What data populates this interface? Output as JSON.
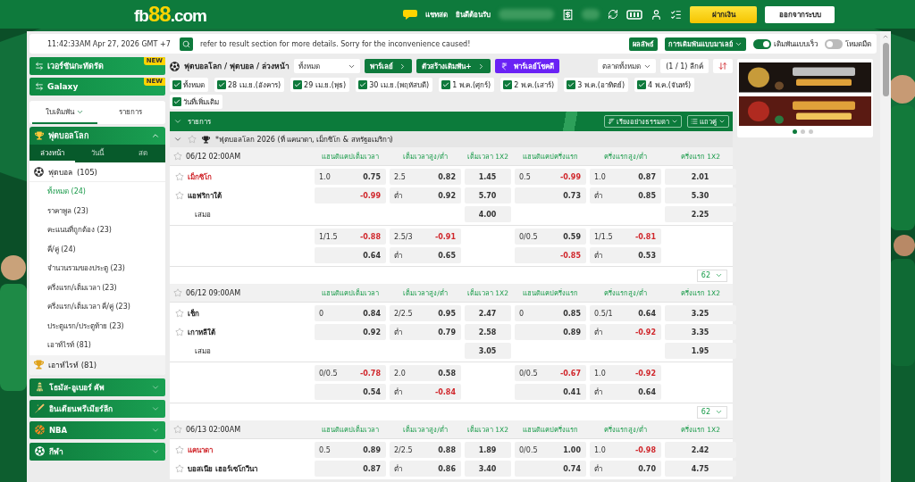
{
  "header": {
    "logo": [
      {
        "text": "fb",
        "accent": false
      },
      {
        "text": "88",
        "accent": true
      },
      {
        "text": ".com",
        "accent": false
      }
    ],
    "chat": "แชทสด",
    "welcome": "ยินดีต้อนรับ",
    "buttons": [
      {
        "label": "ฝากเงิน",
        "kind": "primary"
      },
      {
        "label": "ออกจากระบบ",
        "kind": "secondary"
      }
    ]
  },
  "topbar": {
    "clock": "11:42:33AM Apr 27, 2026 GMT +7",
    "notice": "refer to result section for more details. Sorry for the inconvenience caused!",
    "results": "ผลลัพธ์",
    "odds_type": "การเดิมพันแบบมาเลย์",
    "toggles": [
      {
        "label": "เดิมพันแบบเร็ว",
        "on": true
      },
      {
        "label": "โหมดมืด",
        "on": false
      }
    ]
  },
  "sidebar": {
    "banners": [
      {
        "label": "เวอร์ชันกะทัดรัด",
        "ribbon": "NEW"
      },
      {
        "label": "Galaxy",
        "ribbon": "NEW"
      }
    ],
    "tabs": [
      {
        "label": "ใบเดิมพัน",
        "selected": true
      },
      {
        "label": "รายการ",
        "selected": false
      }
    ],
    "section": {
      "title": "ฟุตบอลโลก",
      "expanded": true,
      "tabs": [
        {
          "label": "ล่วงหน้า",
          "selected": true
        },
        {
          "label": "วันนี้",
          "selected": false
        },
        {
          "label": "สด",
          "selected": false
        }
      ],
      "sport": "ฟุตบอล",
      "sport_count": "(105)",
      "items": [
        {
          "label": "ทั้งหมด",
          "count": "(24)",
          "selected": true
        },
        {
          "label": "ราคาพูล",
          "count": "(23)",
          "selected": false
        },
        {
          "label": "คะแนนที่ถูกต้อง",
          "count": "(23)",
          "selected": false
        },
        {
          "label": "คี่/คู่",
          "count": "(24)",
          "selected": false
        },
        {
          "label": "จำนวนรวมของประตู",
          "count": "(23)",
          "selected": false
        },
        {
          "label": "ครึ่งแรก/เต็มเวลา",
          "count": "(23)",
          "selected": false
        },
        {
          "label": "ครึ่งแรก/เต็มเวลา คี่/คู่",
          "count": "(23)",
          "selected": false
        },
        {
          "label": "ประตูแรก/ประตูท้าย",
          "count": "(23)",
          "selected": false
        },
        {
          "label": "เอาท์ไรท์",
          "count": "(81)",
          "selected": false
        }
      ],
      "outright": "เอาท์ไรท์",
      "outright_count": "(81)"
    },
    "groups": [
      {
        "label": "โธมัส-อูเบอร์ คัพ",
        "kind": "badminton",
        "expanded": false
      },
      {
        "label": "อินเดียนพรีเมียร์ลีก",
        "kind": "cricket",
        "expanded": false
      },
      {
        "label": "NBA",
        "kind": "basketball",
        "expanded": false
      },
      {
        "label": "กีฬา",
        "kind": "football",
        "expanded": false
      }
    ]
  },
  "main": {
    "breadcrumb": "ฟุตบอลโลก / ฟุตบอล / ล่วงหน้า",
    "filter": "ทั้งหมด",
    "actions": [
      {
        "label": "พาร์เลย์",
        "kind": "green"
      },
      {
        "label": "ตัวสร้างเดิมพัน+",
        "kind": "green"
      },
      {
        "label": "พาร์เลย์โชคดี",
        "kind": "purple"
      }
    ],
    "markets": "ตลาดทั้งหมด",
    "league_count": "(1 / 1) ลีกค์",
    "dates": [
      {
        "label": "ทั้งหมด",
        "checked": true
      },
      {
        "label": "28 เม.ย.(อังคาร)",
        "checked": true
      },
      {
        "label": "29 เม.ย.(พุธ)",
        "checked": true
      },
      {
        "label": "30 เม.ย.(พฤหัสบดี)",
        "checked": true
      },
      {
        "label": "1 พ.ค.(ศุกร์)",
        "checked": true
      },
      {
        "label": "2 พ.ค.(เสาร์)",
        "checked": true
      },
      {
        "label": "3 พ.ค.(อาทิตย์)",
        "checked": true
      },
      {
        "label": "4 พ.ค.(จันทร์)",
        "checked": true
      },
      {
        "label": "วันที่เพิ่มเติม",
        "checked": true
      }
    ],
    "table_title": "รายการ",
    "sort": "เรียงอย่างธรรมดา",
    "view": "แถวคู่",
    "league": "*ฟุตบอลโลก 2026 (ที่ แคนาดา, เม็กซิโก & สหรัฐอเมริกา)",
    "matches": [
      {
        "time": "06/12 02:00AM",
        "columns": [
          "แฮนดิแคปเต็มเวลา",
          "เต็มเวลาสูง/ต่ำ",
          "เต็มเวลา 1X2",
          "แฮนดิแคปครึ่งแรก",
          "ครึ่งแรกสูง/ต่ำ",
          "ครึ่งแรก 1X2"
        ],
        "teams": [
          {
            "name": "เม็กซิโก",
            "favorite": true
          },
          {
            "name": "แอฟริกาใต้",
            "favorite": false
          }
        ],
        "draw": "เสมอ",
        "more": "62",
        "lines": [
          [
            [
              {
                "line": "1.0",
                "price": "0.75",
                "negative": false
              },
              {
                "price": "-0.99",
                "negative": true
              }
            ],
            [
              {
                "line": "2.5",
                "price": "0.82",
                "negative": false
              },
              {
                "line": "ต่ำ",
                "price": "0.92",
                "negative": false
              }
            ],
            [
              {
                "price": "1.45",
                "negative": false
              },
              {
                "price": "5.70",
                "negative": false
              },
              {
                "price": "4.00",
                "negative": false
              }
            ],
            [
              {
                "line": "0.5",
                "price": "-0.99",
                "negative": true
              },
              {
                "price": "0.73",
                "negative": false
              }
            ],
            [
              {
                "line": "1.0",
                "price": "0.87",
                "negative": false
              },
              {
                "line": "ต่ำ",
                "price": "0.85",
                "negative": false
              }
            ],
            [
              {
                "price": "2.01",
                "negative": false
              },
              {
                "price": "5.30",
                "negative": false
              },
              {
                "price": "2.25",
                "negative": false
              }
            ]
          ],
          [
            [
              {
                "line": "1/1.5",
                "price": "-0.88",
                "negative": true
              },
              {
                "price": "0.64",
                "negative": false
              }
            ],
            [
              {
                "line": "2.5/3",
                "price": "-0.91",
                "negative": true
              },
              {
                "line": "ต่ำ",
                "price": "0.65",
                "negative": false
              }
            ],
            {
              "kind": "blank"
            },
            [
              {
                "line": "0/0.5",
                "price": "0.59",
                "negative": false
              },
              {
                "price": "-0.85",
                "negative": true
              }
            ],
            [
              {
                "line": "1/1.5",
                "price": "-0.81",
                "negative": true
              },
              {
                "line": "ต่ำ",
                "price": "0.53",
                "negative": false
              }
            ],
            {
              "kind": "blank"
            }
          ]
        ]
      },
      {
        "time": "06/12 09:00AM",
        "columns": [
          "แฮนดิแคปเต็มเวลา",
          "เต็มเวลาสูง/ต่ำ",
          "เต็มเวลา 1X2",
          "แฮนดิแคปครึ่งแรก",
          "ครึ่งแรกสูง/ต่ำ",
          "ครึ่งแรก 1X2"
        ],
        "teams": [
          {
            "name": "เช็ก",
            "favorite": false
          },
          {
            "name": "เกาหลีใต้",
            "favorite": false
          }
        ],
        "draw": "เสมอ",
        "more": "62",
        "lines": [
          [
            [
              {
                "line": "0",
                "price": "0.84",
                "negative": false
              },
              {
                "price": "0.92",
                "negative": false
              }
            ],
            [
              {
                "line": "2/2.5",
                "price": "0.95",
                "negative": false
              },
              {
                "line": "ต่ำ",
                "price": "0.79",
                "negative": false
              }
            ],
            [
              {
                "price": "2.47",
                "negative": false
              },
              {
                "price": "2.58",
                "negative": false
              },
              {
                "price": "3.05",
                "negative": false
              }
            ],
            [
              {
                "line": "0",
                "price": "0.85",
                "negative": false
              },
              {
                "price": "0.89",
                "negative": false
              }
            ],
            [
              {
                "line": "0.5/1",
                "price": "0.64",
                "negative": false
              },
              {
                "line": "ต่ำ",
                "price": "-0.92",
                "negative": true
              }
            ],
            [
              {
                "price": "3.25",
                "negative": false
              },
              {
                "price": "3.35",
                "negative": false
              },
              {
                "price": "1.95",
                "negative": false
              }
            ]
          ],
          [
            [
              {
                "line": "0/0.5",
                "price": "-0.78",
                "negative": true
              },
              {
                "price": "0.54",
                "negative": false
              }
            ],
            [
              {
                "line": "2.0",
                "price": "0.58",
                "negative": false
              },
              {
                "line": "ต่ำ",
                "price": "-0.84",
                "negative": true
              }
            ],
            {
              "kind": "blank"
            },
            [
              {
                "line": "0/0.5",
                "price": "-0.67",
                "negative": true
              },
              {
                "price": "0.41",
                "negative": false
              }
            ],
            [
              {
                "line": "1.0",
                "price": "-0.92",
                "negative": true
              },
              {
                "line": "ต่ำ",
                "price": "0.64",
                "negative": false
              }
            ],
            {
              "kind": "blank"
            }
          ]
        ]
      },
      {
        "time": "06/13 02:00AM",
        "columns": [
          "แฮนดิแคปเต็มเวลา",
          "เต็มเวลาสูง/ต่ำ",
          "เต็มเวลา 1X2",
          "แฮนดิแคปครึ่งแรก",
          "ครึ่งแรกสูง/ต่ำ",
          "ครึ่งแรก 1X2"
        ],
        "teams": [
          {
            "name": "แคนาดา",
            "favorite": true
          },
          {
            "name": "บอสเนีย เฮอร์เซโกวีนา",
            "favorite": false
          }
        ],
        "lines": [
          [
            [
              {
                "line": "0.5",
                "price": "0.89",
                "negative": false
              },
              {
                "price": "0.87",
                "negative": false
              }
            ],
            [
              {
                "line": "2/2.5",
                "price": "0.88",
                "negative": false
              },
              {
                "line": "ต่ำ",
                "price": "0.86",
                "negative": false
              }
            ],
            [
              {
                "price": "1.89",
                "negative": false
              },
              {
                "price": "3.40",
                "negative": false
              }
            ],
            [
              {
                "line": "0/0.5",
                "price": "1.00",
                "negative": false
              },
              {
                "price": "0.74",
                "negative": false
              }
            ],
            [
              {
                "line": "1.0",
                "price": "-0.98",
                "negative": true
              },
              {
                "line": "ต่ำ",
                "price": "0.70",
                "negative": false
              }
            ],
            [
              {
                "price": "2.42",
                "negative": false
              },
              {
                "price": "4.75",
                "negative": false
              }
            ]
          ]
        ]
      }
    ]
  },
  "promos": {
    "dots": [
      {
        "selected": true
      },
      {
        "selected": false
      },
      {
        "selected": false
      }
    ]
  }
}
